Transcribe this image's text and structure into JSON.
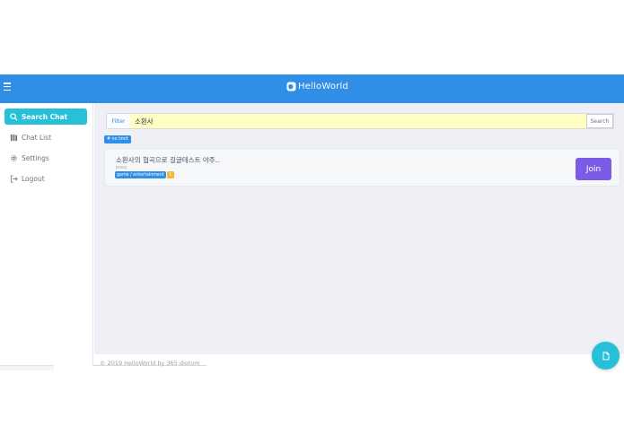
{
  "app": {
    "title": "HelloWorld"
  },
  "sidebar": {
    "items": [
      {
        "label": "Search Chat",
        "icon": "search-icon",
        "active": true
      },
      {
        "label": "Chat List",
        "icon": "chat-list-icon",
        "active": false
      },
      {
        "label": "Settings",
        "icon": "gear-icon",
        "active": false
      },
      {
        "label": "Logout",
        "icon": "logout-icon",
        "active": false
      }
    ]
  },
  "filter": {
    "label": "Filter",
    "value": "소환사",
    "search_label": "Search"
  },
  "tag_nolimit": "# no limit",
  "results": [
    {
      "title": "소환사의 협곡으로 길글테스트 야주..",
      "author": "jossy",
      "category": "game / entertainment",
      "count": "1",
      "join_label": "Join"
    }
  ],
  "footer": {
    "text": "© 2019 HelloWorld by 365 diotom"
  },
  "colors": {
    "topbar": "#2f8ee5",
    "active": "#26c0d9",
    "join": "#7c5ce6",
    "filter_bg": "#ffffc4"
  }
}
